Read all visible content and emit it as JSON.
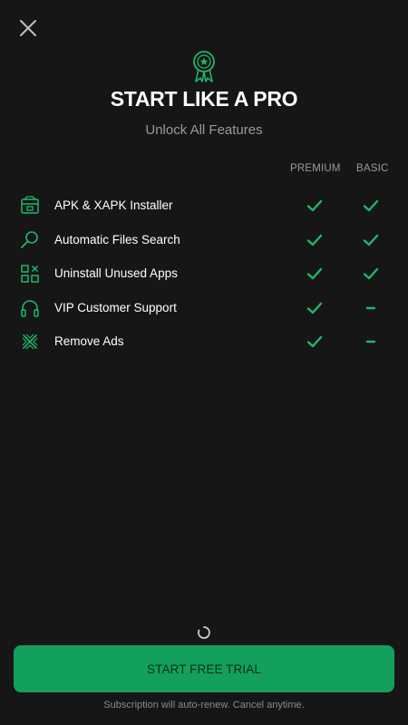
{
  "header": {
    "close_icon": "close-icon",
    "badge_icon": "award-ribbon-icon",
    "title": "START LIKE A PRO",
    "subtitle": "Unlock All Features"
  },
  "columns": {
    "premium": "PREMIUM",
    "basic": "BASIC"
  },
  "features": [
    {
      "icon": "package-icon",
      "label": "APK & XAPK Installer",
      "premium": "check",
      "basic": "check"
    },
    {
      "icon": "search-icon",
      "label": "Automatic Files Search",
      "premium": "check",
      "basic": "check"
    },
    {
      "icon": "apps-grid-icon",
      "label": "Uninstall Unused Apps",
      "premium": "check",
      "basic": "check"
    },
    {
      "icon": "headphones-icon",
      "label": "VIP Customer Support",
      "premium": "check",
      "basic": "dash"
    },
    {
      "icon": "remove-ads-icon",
      "label": "Remove Ads",
      "premium": "check",
      "basic": "dash"
    }
  ],
  "cta": {
    "label": "START FREE TRIAL"
  },
  "footer": {
    "text": "Subscription will auto-renew. Cancel anytime."
  },
  "colors": {
    "background": "#161616",
    "accent": "#12a05c",
    "check": "#1fb86a"
  }
}
